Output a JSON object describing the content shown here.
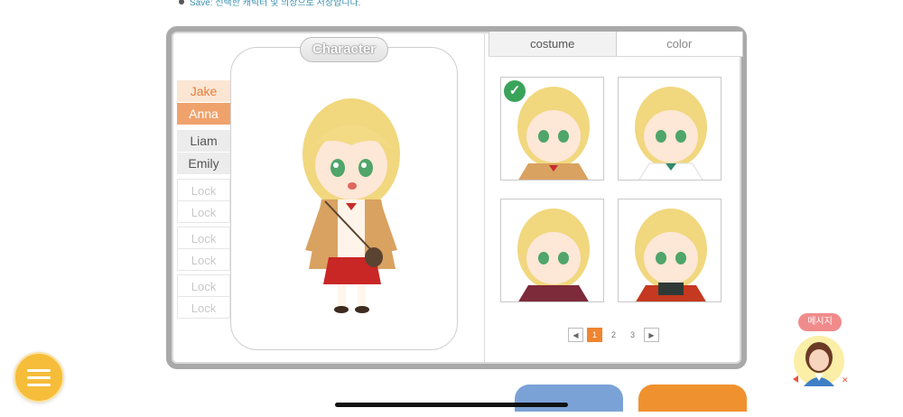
{
  "top_note": "Save: 선택한 캐릭터 및 의상으로 저장합니다.",
  "card_title": "Character",
  "names": {
    "selected_light": "Jake",
    "selected_dark": "Anna",
    "group2": [
      "Liam",
      "Emily"
    ],
    "locks": [
      "Lock",
      "Lock",
      "Lock",
      "Lock",
      "Lock",
      "Lock"
    ]
  },
  "tabs": {
    "costume": "costume",
    "color": "color"
  },
  "pager": {
    "prev": "◀",
    "pages": [
      "1",
      "2",
      "3"
    ],
    "next": "▶",
    "current": "1"
  },
  "message_badge": "메시지",
  "icons": {
    "check": "check-icon",
    "menu": "hamburger-menu-icon",
    "prev": "chevron-left-icon",
    "next": "chevron-right-icon"
  },
  "colors": {
    "accent_orange": "#f0852f",
    "check_green": "#3aa35a",
    "menu_yellow": "#f6bd3a"
  }
}
